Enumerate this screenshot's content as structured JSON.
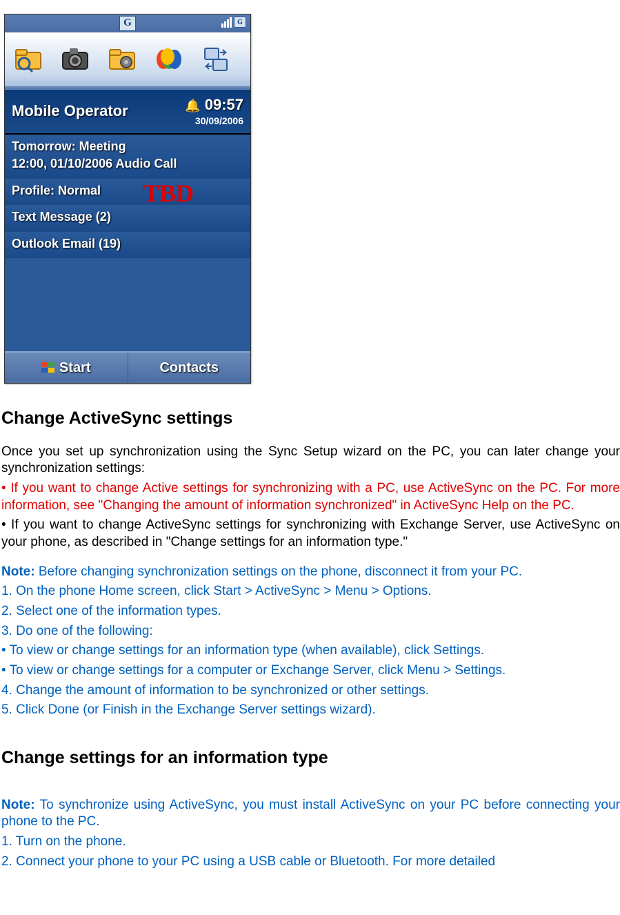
{
  "phone": {
    "status_g": "G",
    "status_g2": "G",
    "operator": "Mobile Operator",
    "time": "09:57",
    "date": "30/09/2006",
    "tomorrow_label": "Tomorrow: Meeting",
    "tomorrow_detail": "12:00, 01/10/2006 Audio Call",
    "profile": "Profile: Normal",
    "tbd": "TBD",
    "text_msg": "Text Message (2)",
    "outlook": "Outlook Email (19)",
    "softkey_left": "Start",
    "softkey_right": "Contacts"
  },
  "section1": {
    "heading": "Change ActiveSync settings",
    "intro": "Once you set up synchronization using the Sync Setup wizard on the PC, you can later change your synchronization settings:",
    "bullet1": "• If you want to change Active settings for synchronizing with a PC, use ActiveSync on the PC. For more information, see \"Changing the amount of information synchronized\" in ActiveSync Help on the PC.",
    "bullet2": "• If you want to change ActiveSync settings for synchronizing with Exchange Server, use ActiveSync on your phone, as described in \"Change settings for an information type.\"",
    "note_label": "Note:",
    "note_text": " Before changing synchronization settings on the phone, disconnect it from your PC.",
    "step1": "1. On the phone Home screen, click Start > ActiveSync > Menu > Options.",
    "step2": "2. Select one of the information types.",
    "step3": "3. Do one of the following:",
    "step3a": "• To view or change settings for an information type (when available), click Settings.",
    "step3b": "• To view or change settings for a computer or Exchange Server, click Menu > Settings.",
    "step4": "4. Change the amount of information to be synchronized or other settings.",
    "step5": "5. Click Done (or Finish in the Exchange Server settings wizard)."
  },
  "section2": {
    "heading": "Change settings for an information type",
    "note_label": "Note:",
    "note_text": " To synchronize using ActiveSync, you must install ActiveSync on your PC before connecting your phone to the PC.",
    "step1": "1. Turn on the phone.",
    "step2": "2. Connect your phone to your PC using a USB cable or Bluetooth. For more detailed"
  }
}
